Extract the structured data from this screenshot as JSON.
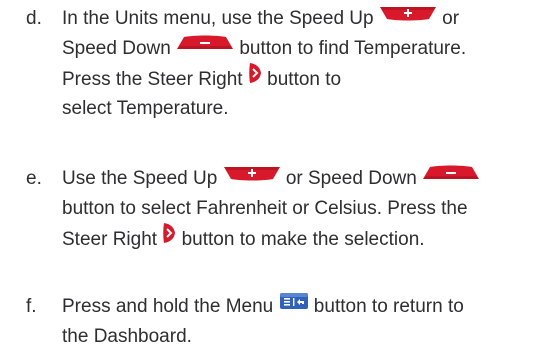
{
  "steps": [
    {
      "letter": "d.",
      "lines": [
        [
          "In the Units menu, use the Speed Up ",
          {
            "icon": "speed-up-icon"
          },
          " or"
        ],
        [
          "Speed Down ",
          {
            "icon": "speed-down-icon"
          },
          " button to find Temperature."
        ],
        [
          "Press the Steer Right ",
          {
            "icon": "steer-right-icon"
          },
          " button to"
        ],
        [
          "select Temperature."
        ]
      ]
    },
    {
      "letter": "e.",
      "lines": [
        [
          "Use the Speed Up ",
          {
            "icon": "speed-up-icon"
          },
          " or Speed Down ",
          {
            "icon": "speed-down-icon"
          }
        ],
        [
          "button to select Fahrenheit or Celsius. Press the"
        ],
        [
          "Steer Right ",
          {
            "icon": "steer-right-icon"
          },
          " button to make the selection."
        ]
      ]
    },
    {
      "letter": "f.",
      "lines": [
        [
          "Press and hold the Menu ",
          {
            "icon": "menu-icon"
          },
          " button to return to"
        ],
        [
          "the Dashboard."
        ]
      ]
    }
  ],
  "colors": {
    "text": "#2e2e30",
    "button_red": "#d7192b",
    "button_red_dark": "#a40f1d",
    "menu_blue": "#2f62b8"
  }
}
